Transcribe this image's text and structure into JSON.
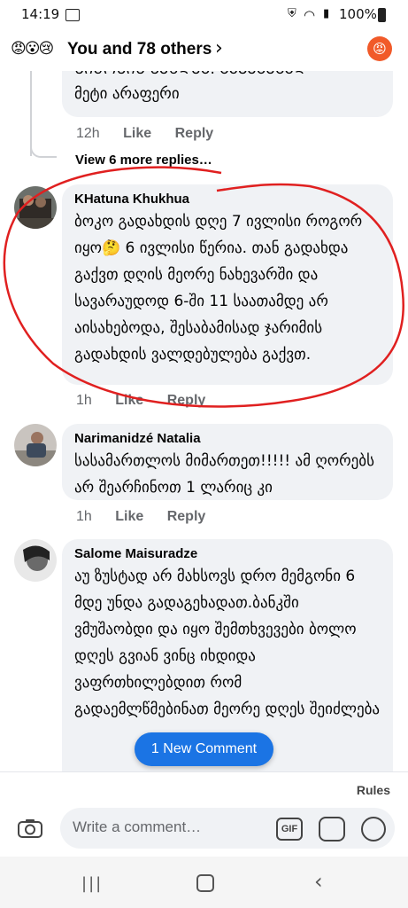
{
  "status_bar": {
    "time": "14:19",
    "battery": "100%"
  },
  "header": {
    "reactions": "😡😮😢",
    "title": "You and 78 others",
    "right_reaction": "😡"
  },
  "prev_comment": {
    "text": "ᲡᲘᲛᲝᲡᲘᲡ ᲡᲔᲜᲓᲔᲑ. ᲒᲐᲕᲔᲒᲔᲑᲐᲓ\nმეტი არაფერი",
    "time": "12h",
    "like": "Like",
    "reply": "Reply"
  },
  "view_more_replies": "View 6 more replies…",
  "comments": [
    {
      "author": "KHatuna Khukhua",
      "text": "ბოკო გადახდის დღე 7 ივლისი როგორ იყო🤔 6 ივლისი წერია.  თან გადახდა გაქვთ  დღის მეორე ნახევარში და სავარაუდოდ 6-ში 11 საათამდე არ აისახებოდა, შესაბამისად ჯარიმის გადახდის ვალდებულება გაქვთ.",
      "time": "1h",
      "like": "Like",
      "reply": "Reply"
    },
    {
      "author": "Narimanidzé Natalia",
      "text": "სასამართლოს მიმართეთ!!!!! ამ ღორებს არ შეარჩინოთ 1 ლარიც კი",
      "time": "1h",
      "like": "Like",
      "reply": "Reply"
    },
    {
      "author": "Salome Maisuradze",
      "text": "აუ ზუსტად არ მახსოვს დრო მემგონი 6 მდე უნდა გადაგეხადათ.ბანკში ვმუშაობდი და იყო შემთხვევები ბოლო დღეს გვიან ვინც იხდიდა ვაფრთხილებდით რომ გადაემლწმებინათ მეორე დღეს შეიძლება",
      "time": "",
      "like": "",
      "reply": ""
    }
  ],
  "new_comment_pill": "1 New Comment",
  "composer": {
    "rules": "Rules",
    "placeholder": "Write a comment…",
    "gif": "GIF"
  },
  "colors": {
    "accent": "#1b74e4",
    "bubble": "#f0f2f5",
    "annotation": "#e02020"
  }
}
